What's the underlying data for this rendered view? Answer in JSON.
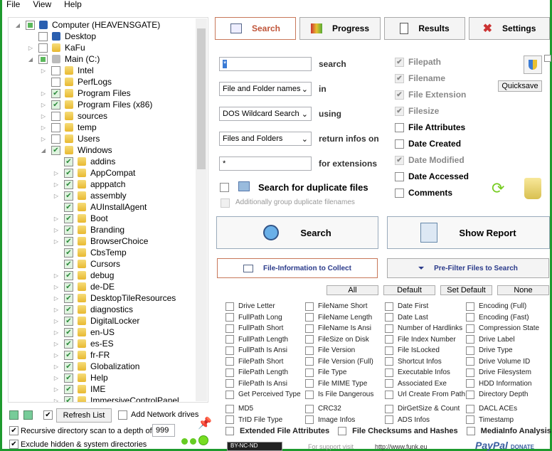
{
  "menu": [
    "File",
    "View",
    "Help"
  ],
  "tree": [
    {
      "label": "Computer (HEAVENSGATE)",
      "level": 0,
      "exp": "open",
      "state": "part",
      "icon": "computer"
    },
    {
      "label": "Desktop",
      "level": 1,
      "exp": "none",
      "state": "off",
      "icon": "desktop"
    },
    {
      "label": "KaFu",
      "level": 1,
      "exp": "closed",
      "state": "off",
      "icon": "folder"
    },
    {
      "label": "Main (C:)",
      "level": 1,
      "exp": "open",
      "state": "part",
      "icon": "drive"
    },
    {
      "label": "Intel",
      "level": 2,
      "exp": "closed",
      "state": "off",
      "icon": "folder"
    },
    {
      "label": "PerfLogs",
      "level": 2,
      "exp": "none",
      "state": "off",
      "icon": "folder"
    },
    {
      "label": "Program Files",
      "level": 2,
      "exp": "closed",
      "state": "on",
      "icon": "folder"
    },
    {
      "label": "Program Files (x86)",
      "level": 2,
      "exp": "closed",
      "state": "on",
      "icon": "folder"
    },
    {
      "label": "sources",
      "level": 2,
      "exp": "closed",
      "state": "off",
      "icon": "folder"
    },
    {
      "label": "temp",
      "level": 2,
      "exp": "closed",
      "state": "off",
      "icon": "folder"
    },
    {
      "label": "Users",
      "level": 2,
      "exp": "closed",
      "state": "off",
      "icon": "folder"
    },
    {
      "label": "Windows",
      "level": 2,
      "exp": "open",
      "state": "on",
      "icon": "folder"
    },
    {
      "label": "addins",
      "level": 3,
      "exp": "none",
      "state": "on",
      "icon": "folder"
    },
    {
      "label": "AppCompat",
      "level": 3,
      "exp": "closed",
      "state": "on",
      "icon": "folder"
    },
    {
      "label": "apppatch",
      "level": 3,
      "exp": "closed",
      "state": "on",
      "icon": "folder"
    },
    {
      "label": "assembly",
      "level": 3,
      "exp": "closed",
      "state": "on",
      "icon": "folder"
    },
    {
      "label": "AUInstallAgent",
      "level": 3,
      "exp": "none",
      "state": "on",
      "icon": "folder"
    },
    {
      "label": "Boot",
      "level": 3,
      "exp": "closed",
      "state": "on",
      "icon": "folder"
    },
    {
      "label": "Branding",
      "level": 3,
      "exp": "closed",
      "state": "on",
      "icon": "folder"
    },
    {
      "label": "BrowserChoice",
      "level": 3,
      "exp": "closed",
      "state": "on",
      "icon": "folder"
    },
    {
      "label": "CbsTemp",
      "level": 3,
      "exp": "none",
      "state": "on",
      "icon": "folder"
    },
    {
      "label": "Cursors",
      "level": 3,
      "exp": "none",
      "state": "on",
      "icon": "folder"
    },
    {
      "label": "debug",
      "level": 3,
      "exp": "closed",
      "state": "on",
      "icon": "folder"
    },
    {
      "label": "de-DE",
      "level": 3,
      "exp": "closed",
      "state": "on",
      "icon": "folder"
    },
    {
      "label": "DesktopTileResources",
      "level": 3,
      "exp": "closed",
      "state": "on",
      "icon": "folder"
    },
    {
      "label": "diagnostics",
      "level": 3,
      "exp": "closed",
      "state": "on",
      "icon": "folder"
    },
    {
      "label": "DigitalLocker",
      "level": 3,
      "exp": "closed",
      "state": "on",
      "icon": "folder"
    },
    {
      "label": "en-US",
      "level": 3,
      "exp": "closed",
      "state": "on",
      "icon": "folder"
    },
    {
      "label": "es-ES",
      "level": 3,
      "exp": "closed",
      "state": "on",
      "icon": "folder"
    },
    {
      "label": "fr-FR",
      "level": 3,
      "exp": "closed",
      "state": "on",
      "icon": "folder"
    },
    {
      "label": "Globalization",
      "level": 3,
      "exp": "closed",
      "state": "on",
      "icon": "folder"
    },
    {
      "label": "Help",
      "level": 3,
      "exp": "closed",
      "state": "on",
      "icon": "folder"
    },
    {
      "label": "IME",
      "level": 3,
      "exp": "closed",
      "state": "on",
      "icon": "folder"
    },
    {
      "label": "ImmersiveControlPanel",
      "level": 3,
      "exp": "closed",
      "state": "on",
      "icon": "folder"
    }
  ],
  "left_bottom": {
    "refresh": "Refresh List",
    "add_network": "Add Network drives",
    "recursive": "Recursive directory scan to a depth of",
    "depth": "999",
    "exclude": "Exclude hidden & system directories"
  },
  "tabs": [
    {
      "label": "Search",
      "icon": "search-tab-icon"
    },
    {
      "label": "Progress",
      "icon": "progress-tab-icon"
    },
    {
      "label": "Results",
      "icon": "results-tab-icon"
    },
    {
      "label": "Settings",
      "icon": "settings-tab-icon"
    }
  ],
  "search": {
    "query": "*",
    "query_label": "search",
    "in_value": "File and Folder names",
    "in_label": "in",
    "using_value": "DOS Wildcard Search",
    "using_label": "using",
    "return_value": "Files and Folders",
    "return_label": "return infos on",
    "ext_value": "*",
    "ext_label": "for extensions",
    "duplicates": "Search for duplicate files",
    "group_dup": "Additionally group duplicate filenames",
    "quicksave": "Quicksave",
    "search_btn": "Search",
    "report_btn": "Show Report",
    "file_info_tab": "File-Information to Collect",
    "prefilter_tab": "Pre-Filter Files to Search"
  },
  "options": [
    {
      "label": "Filepath",
      "checked": true,
      "disabled": true
    },
    {
      "label": "Filename",
      "checked": true,
      "disabled": true
    },
    {
      "label": "File Extension",
      "checked": true,
      "disabled": true
    },
    {
      "label": "Filesize",
      "checked": true,
      "disabled": true
    },
    {
      "label": "File Attributes",
      "checked": false,
      "disabled": false
    },
    {
      "label": "Date Created",
      "checked": false,
      "disabled": false
    },
    {
      "label": "Date Modified",
      "checked": true,
      "disabled": true
    },
    {
      "label": "Date Accessed",
      "checked": false,
      "disabled": false
    },
    {
      "label": "Comments",
      "checked": false,
      "disabled": false
    }
  ],
  "preset_buttons": [
    "All",
    "Default",
    "Set Default",
    "None"
  ],
  "fields": [
    "Drive Letter",
    "FileName Short",
    "Date First",
    "Encoding (Full)",
    "FullPath Long",
    "FileName Length",
    "Date Last",
    "Encoding (Fast)",
    "FullPath Short",
    "FileName Is Ansi",
    "Number of Hardlinks",
    "Compression State",
    "FullPath Length",
    "FileSize on Disk",
    "File Index Number",
    "Drive Label",
    "FullPath Is Ansi",
    "File Version",
    "File IsLocked",
    "Drive Type",
    "FilePath Short",
    "File Version (Full)",
    "Shortcut Infos",
    "Drive Volume ID",
    "FilePath Length",
    "File Type",
    "Executable Infos",
    "Drive Filesystem",
    "FilePath Is Ansi",
    "File MIME Type",
    "Associated Exe",
    "HDD Information",
    "Get Perceived Type",
    "Is File Dangerous",
    "Url Create From Path",
    "Directory Depth"
  ],
  "fields2": [
    "MD5",
    "CRC32",
    "DirGetSize & Count",
    "DACL ACEs",
    "TrID File Type",
    "Image Infos",
    "ADS Infos",
    "Timestamp"
  ],
  "extended": [
    "Extended File Attributes",
    "File Checksums and Hashes",
    "MediaInfo Analysis"
  ],
  "footer": {
    "license": "BY-NC-ND",
    "support": "For support visit",
    "url": "http://www.funk.eu",
    "paypal": "PayPal",
    "donate": "DONATE"
  }
}
